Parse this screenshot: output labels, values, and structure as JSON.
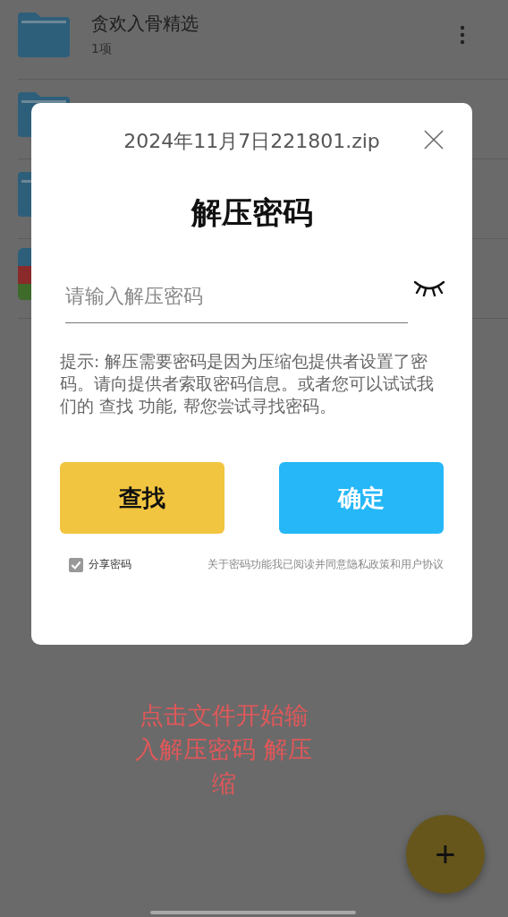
{
  "files": [
    {
      "kind": "folder",
      "name": "贪欢入骨精选",
      "meta": "1项",
      "menu": true
    },
    {
      "kind": "folder"
    },
    {
      "kind": "folder"
    },
    {
      "kind": "archive"
    }
  ],
  "dialog": {
    "filename": "2024年11月7日221801.zip",
    "title": "解压密码",
    "password": {
      "placeholder": "请输入解压密码",
      "visible": false
    },
    "hint": "提示: 解压需要密码是因为压缩包提供者设置了密码。请向提供者索取密码信息。或者您可以试试我们的 查找 功能, 帮您尝试寻找密码。",
    "buttons": [
      {
        "kind": "find",
        "label": "查找"
      },
      {
        "kind": "confirm",
        "label": "确定"
      }
    ],
    "share": {
      "label": "分享密码",
      "checked": true
    },
    "agreement": "关于密码功能我已阅读并同意隐私政策和用户协议"
  },
  "caption": "点击文件开始输入解压密码  解压缩",
  "fab": {
    "label": "+"
  }
}
